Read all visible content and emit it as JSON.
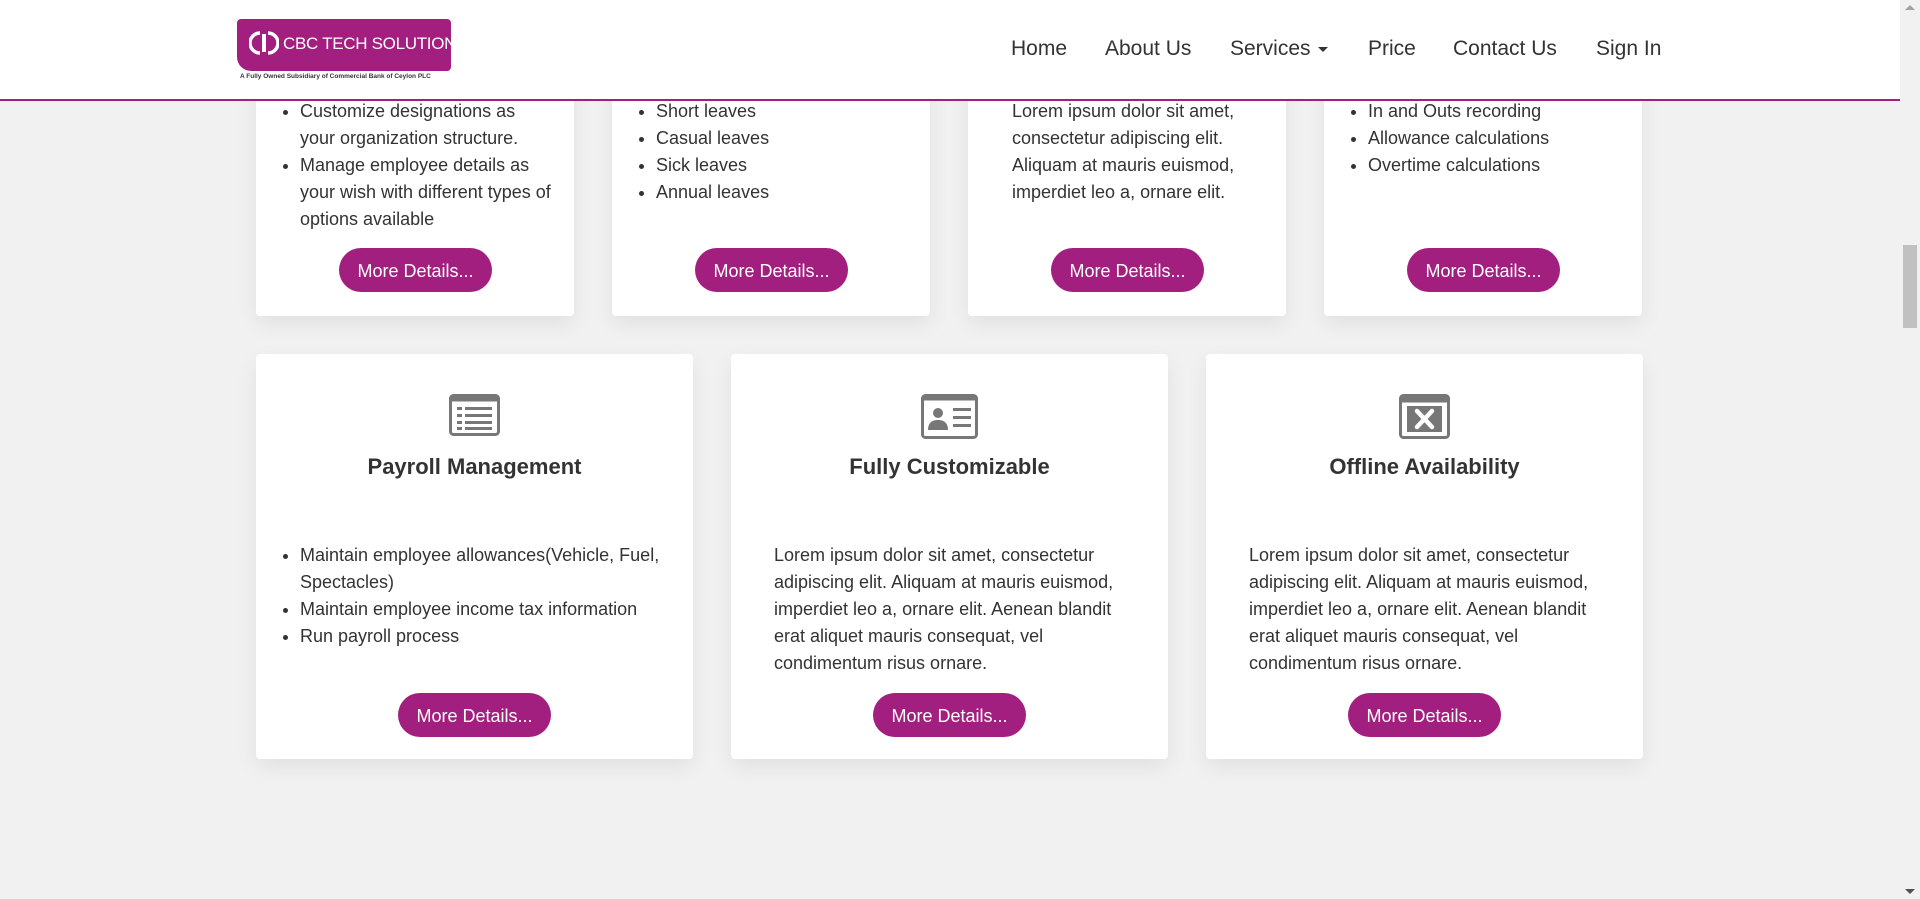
{
  "header": {
    "logo_text": "CBC TECH SOLUTIONS",
    "logo_tagline": "A Fully Owned Subsidiary of Commercial Bank of Ceylon PLC",
    "nav": [
      "Home",
      "About Us",
      "Services",
      "Price",
      "Contact Us",
      "Sign In"
    ]
  },
  "colors": {
    "accent": "#a31f7f",
    "background": "#f1f1f1",
    "card": "#ffffff"
  },
  "top_cards": [
    {
      "items": [
        "Customize designations as your organization structure.",
        "Manage employee details as your wish with different types of options available"
      ],
      "button": "More Details..."
    },
    {
      "items": [
        "Short leaves",
        "Casual leaves",
        "Sick leaves",
        "Annual leaves"
      ],
      "button": "More Details..."
    },
    {
      "paragraph": "Lorem ipsum dolor sit amet, consectetur adipiscing elit. Aliquam at mauris euismod, imperdiet leo a, ornare elit.",
      "button": "More Details..."
    },
    {
      "items": [
        "In and Outs recording",
        "Allowance calculations",
        "Overtime calculations"
      ],
      "button": "More Details..."
    }
  ],
  "bottom_cards": [
    {
      "icon": "list-icon",
      "title": "Payroll Management",
      "items": [
        "Maintain employee allowances(Vehicle, Fuel, Spectacles)",
        "Maintain employee income tax information",
        "Run payroll process"
      ],
      "button": "More Details..."
    },
    {
      "icon": "id-card-icon",
      "title": "Fully Customizable",
      "paragraph": "Lorem ipsum dolor sit amet, consectetur adipiscing elit. Aliquam at mauris euismod, imperdiet leo a, ornare elit. Aenean blandit erat aliquet mauris consequat, vel condimentum risus ornare.",
      "button": "More Details..."
    },
    {
      "icon": "close-box-icon",
      "title": "Offline Availability",
      "paragraph": "Lorem ipsum dolor sit amet, consectetur adipiscing elit. Aliquam at mauris euismod, imperdiet leo a, ornare elit. Aenean blandit erat aliquet mauris consequat, vel condimentum risus ornare.",
      "button": "More Details..."
    }
  ]
}
